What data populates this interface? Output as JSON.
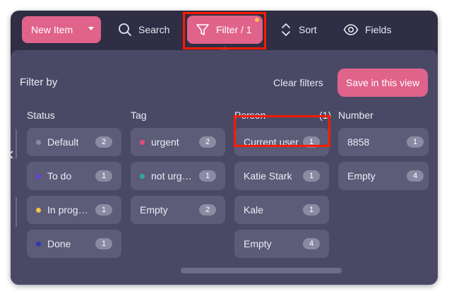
{
  "toolbar": {
    "new_item": "New Item",
    "search": "Search",
    "filter": "Filter / 1",
    "sort": "Sort",
    "fields": "Fields"
  },
  "panel": {
    "title": "Filter by",
    "clear": "Clear filters",
    "save": "Save in this view"
  },
  "columns": {
    "status": {
      "header": "Status",
      "items": [
        {
          "label": "Default",
          "count": "2",
          "color": "#8a8aa0"
        },
        {
          "label": "To do",
          "count": "1",
          "color": "#6a3fd0"
        },
        {
          "label": "In progress",
          "count": "1",
          "color": "#f2c14e"
        },
        {
          "label": "Done",
          "count": "1",
          "color": "#2c38b8"
        }
      ]
    },
    "tag": {
      "header": "Tag",
      "items": [
        {
          "label": "urgent",
          "count": "2",
          "color": "#e0507a"
        },
        {
          "label": "not urgent",
          "count": "1",
          "color": "#2fa7a9"
        },
        {
          "label": "Empty",
          "count": "2"
        }
      ]
    },
    "person": {
      "header": "Person",
      "selected_count": "(1)",
      "items": [
        {
          "label": "Current user",
          "count": "1"
        },
        {
          "label": "Katie Stark",
          "count": "1"
        },
        {
          "label": "Kale",
          "count": "1"
        },
        {
          "label": "Empty",
          "count": "4"
        }
      ]
    },
    "number": {
      "header": "Number",
      "items": [
        {
          "label": "8858",
          "count": "1"
        },
        {
          "label": "Empty",
          "count": "4"
        }
      ]
    }
  },
  "colors": {
    "accent": "#e0638b",
    "background": "#2f2e44",
    "panel": "#4a4965",
    "chip": "#5c5b78",
    "highlight": "#ff1a00"
  }
}
